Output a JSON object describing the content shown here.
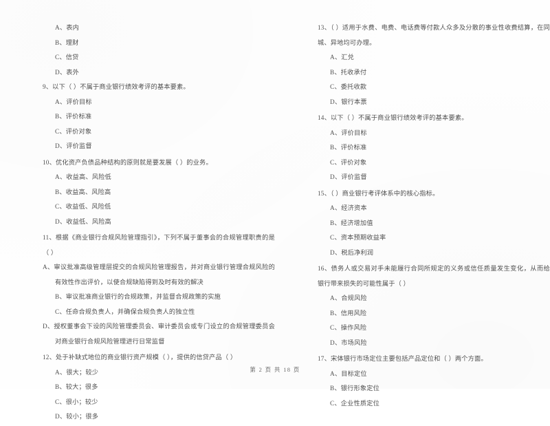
{
  "document": {
    "page_footer": "第 2 页 共 18 页",
    "background_color": "#fefefe",
    "text_color": "#4f4f4f"
  },
  "left_column": {
    "continued_options": [
      "A、表内",
      "B、理财",
      "C、信贷",
      "D、表外"
    ],
    "questions": [
      {
        "number": "9",
        "stem": "9、以下（      ）不属于商业银行绩效考评的基本要素。",
        "options": [
          "A、评价目标",
          "B、评价标准",
          "C、评价对象",
          "D、评价监督"
        ]
      },
      {
        "number": "10",
        "stem": "10、优化资产负债品种结构的原则就是要发展（      ）的业务。",
        "options": [
          "A、收益高、风险低",
          "B、收益高、风险高",
          "C、收益低、风险低",
          "D、收益低、风险高"
        ]
      },
      {
        "number": "11",
        "stem": "11、根据《商业银行合规风险管理指引》，下列不属于董事会的合规管理职责的是（      ）",
        "options": [
          "A、审议批准高级管理层提交的合规风险管理报告，并对商业银行管理合规风险的有效性作出评价，以使合规缺陷得到及时有效的解决",
          "B、审议批准商业银行的合规政策，并监督合规政策的实施",
          "C、任命合规负责人，并确保合规负责人的独立性",
          "D、授权董事会下设的风险管理委员会、审计委员会或专门设立的合规管理委员会对商业银行合规风险管理进行日常监督"
        ]
      },
      {
        "number": "12",
        "stem": "12、处于补缺式地位的商业银行资产规模（      ），提供的信贷产品（      ）",
        "options": [
          "A、很大；较少",
          "B、较大；很多",
          "C、很小；较少",
          "D、较小；很多"
        ]
      }
    ]
  },
  "right_column": {
    "questions": [
      {
        "number": "13",
        "stem": "13、（      ）适用于水费、电费、电话费等付款人众多及分散的事业性收费结算，在同城、异地均可办理。",
        "options": [
          "A、汇兑",
          "B、托收承付",
          "C、委托收款",
          "D、银行本票"
        ]
      },
      {
        "number": "14",
        "stem": "14、以下（      ）不属于商业银行绩效考评的基本要素。",
        "options": [
          "A、评价目标",
          "B、评价标准",
          "C、评价对象",
          "D、评价监督"
        ]
      },
      {
        "number": "15",
        "stem": "15、（      ）商业银行考评体系中的核心指标。",
        "options": [
          "A、经济资本",
          "B、经济增加值",
          "C、资本预期收益率",
          "D、税后净利润"
        ]
      },
      {
        "number": "16",
        "stem": "16、债务人或交易对手未能履行合同所规定的义务或信任质量发生变化，从而给银行带来损失的可能性属于（      ）",
        "options": [
          "A、合规风险",
          "B、信用风险",
          "C、操作风险",
          "D、市场风险"
        ]
      },
      {
        "number": "17",
        "stem": "17、宋体银行市场定位主要包括产品定位和（      ）两个方面。",
        "options": [
          "A、目标定位",
          "B、银行形象定位",
          "C、企业性质定位"
        ]
      }
    ]
  }
}
